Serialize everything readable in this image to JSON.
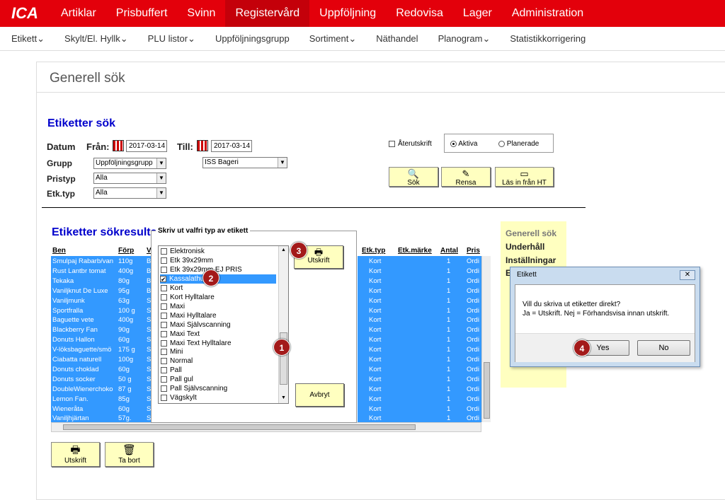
{
  "topnav": {
    "logo": "ICA",
    "items": [
      "Artiklar",
      "Prisbuffert",
      "Svinn",
      "Registervård",
      "Uppföljning",
      "Redovisa",
      "Lager",
      "Administration"
    ]
  },
  "subnav": [
    "Etikett",
    "Skylt/El. Hyllk",
    "PLU listor",
    "Uppföljningsgrupp",
    "Sortiment",
    "Näthandel",
    "Planogram",
    "Statistikkorrigering"
  ],
  "page_title": "Generell sök",
  "search": {
    "title": "Etiketter sök",
    "datum_label": "Datum",
    "fran_label": "Från:",
    "fran_value": "2017-03-14",
    "till_label": "Till:",
    "till_value": "2017-03-14",
    "grupp_label": "Grupp",
    "grupp_value": "Uppföljningsgrupp",
    "grupp2_value": "ISS Bageri",
    "pristyp_label": "Pristyp",
    "pristyp_value": "Alla",
    "etktyp_label": "Etk.typ",
    "etktyp_value": "Alla",
    "aterutskrift_label": "Återutskrift",
    "radio_aktiva": "Aktiva",
    "radio_planerade": "Planerade",
    "btn_sok": "Sök",
    "btn_rensa": "Rensa",
    "btn_las": "Läs in från HT"
  },
  "results": {
    "title": "Etiketter sökresultat",
    "headers": {
      "ben": "Ben",
      "forp": "Förp",
      "v": "V",
      "etktyp": "Etk.typ",
      "etkmarke": "Etk.märke",
      "antal": "Antal",
      "pris": "Pris"
    },
    "rows": [
      {
        "ben": "Smulpaj Rabarb/van",
        "forp": "110g",
        "v": "B",
        "etktyp": "Kort",
        "antal": "1",
        "pris": "Ordi"
      },
      {
        "ben": "Rust Lantbr tomat",
        "forp": "400g",
        "v": "B",
        "etktyp": "Kort",
        "antal": "1",
        "pris": "Ordi"
      },
      {
        "ben": "Tekaka",
        "forp": "80g",
        "v": "B",
        "etktyp": "Kort",
        "antal": "1",
        "pris": "Ordi"
      },
      {
        "ben": "Vaniljknut De Luxe",
        "forp": "95g",
        "v": "B",
        "etktyp": "Kort",
        "antal": "1",
        "pris": "Ordi"
      },
      {
        "ben": "Vaniljmunk",
        "forp": "63g",
        "v": "S",
        "etktyp": "Kort",
        "antal": "1",
        "pris": "Ordi"
      },
      {
        "ben": "Sportfralla",
        "forp": "100 g",
        "v": "S",
        "etktyp": "Kort",
        "antal": "1",
        "pris": "Ordi"
      },
      {
        "ben": "Baguette vete",
        "forp": "400g",
        "v": "S",
        "etktyp": "Kort",
        "antal": "1",
        "pris": "Ordi"
      },
      {
        "ben": "Blackberry Fan",
        "forp": "90g",
        "v": "S",
        "etktyp": "Kort",
        "antal": "1",
        "pris": "Ordi"
      },
      {
        "ben": "Donuts Hallon",
        "forp": "60g",
        "v": "S",
        "etktyp": "Kort",
        "antal": "1",
        "pris": "Ordi"
      },
      {
        "ben": "V-löksbaguette/smö",
        "forp": "175 g",
        "v": "S",
        "etktyp": "Kort",
        "antal": "1",
        "pris": "Ordi"
      },
      {
        "ben": "Ciabatta naturell",
        "forp": "100g",
        "v": "S",
        "etktyp": "Kort",
        "antal": "1",
        "pris": "Ordi"
      },
      {
        "ben": "Donuts choklad",
        "forp": "60g",
        "v": "S",
        "etktyp": "Kort",
        "antal": "1",
        "pris": "Ordi"
      },
      {
        "ben": "Donuts socker",
        "forp": "50 g",
        "v": "S",
        "etktyp": "Kort",
        "antal": "1",
        "pris": "Ordi"
      },
      {
        "ben": "DoubleWienerchoko",
        "forp": "87 g",
        "v": "S",
        "etktyp": "Kort",
        "antal": "1",
        "pris": "Ordi"
      },
      {
        "ben": "Lemon Fan.",
        "forp": "85g",
        "v": "S",
        "etktyp": "Kort",
        "antal": "1",
        "pris": "Ordi"
      },
      {
        "ben": "Wieneråta",
        "forp": "60g",
        "v": "S",
        "etktyp": "Kort",
        "antal": "1",
        "pris": "Ordi"
      },
      {
        "ben": "Vaniljhjärtan",
        "forp": "57g.",
        "v": "S",
        "etktyp": "Kort",
        "antal": "1",
        "pris": "Ordi"
      }
    ],
    "btn_utskrift": "Utskrift",
    "btn_tabort": "Ta bort"
  },
  "print_dialog": {
    "title": "Skriv ut valfri typ av etikett",
    "items": [
      {
        "label": "Elektronisk",
        "checked": false
      },
      {
        "label": "Etk 39x29mm",
        "checked": false
      },
      {
        "label": "Etk 39x29mm EJ PRIS",
        "checked": false
      },
      {
        "label": "Kassalathurs",
        "checked": true
      },
      {
        "label": "Kort",
        "checked": false
      },
      {
        "label": "Kort Hylltalare",
        "checked": false
      },
      {
        "label": "Maxi",
        "checked": false
      },
      {
        "label": "Maxi Hylltalare",
        "checked": false
      },
      {
        "label": "Maxi Självscanning",
        "checked": false
      },
      {
        "label": "Maxi Text",
        "checked": false
      },
      {
        "label": "Maxi Text Hylltalare",
        "checked": false
      },
      {
        "label": "Mini",
        "checked": false
      },
      {
        "label": "Normal",
        "checked": false
      },
      {
        "label": "Pall",
        "checked": false
      },
      {
        "label": "Pall gul",
        "checked": false
      },
      {
        "label": "Pall Självscanning",
        "checked": false
      },
      {
        "label": "Vägskylt",
        "checked": false
      }
    ],
    "btn_utskrift": "Utskrift",
    "btn_avbryt": "Avbryt"
  },
  "side_panel": [
    "Generell sök",
    "Underhåll",
    "Inställningar",
    "E"
  ],
  "confirm_dialog": {
    "title": "Etikett",
    "close": "✕",
    "line1": "Vill du skriva ut etiketter direkt?",
    "line2": "Ja = Utskrift. Nej = Förhandsvisa innan utskrift.",
    "btn_yes": "Yes",
    "btn_no": "No"
  },
  "markers": [
    "1",
    "2",
    "3",
    "4"
  ]
}
